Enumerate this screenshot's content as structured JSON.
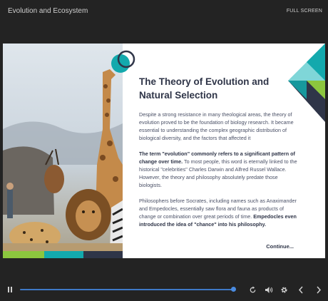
{
  "header": {
    "course_title": "Evolution and Ecosystem",
    "fullscreen_label": "FULL SCREEN"
  },
  "slide": {
    "title_line1": "The Theory of Evolution and",
    "title_line2": "Natural Selection",
    "paragraph1": "Despite a strong resistance in many theological areas, the theory of evolution proved to be the foundation of biology research. It became essential to understanding the complex geographic distribution of biological diversity, and the factors that affected it",
    "paragraph2_bold": "The term \"evolution\" commonly refers to a significant pattern of change over time.",
    "paragraph2_rest": " To most people, this word is eternally linked to the historical \"celebrities\" Charles Darwin and Alfred Russel Wallace. However, the theory and philosophy absolutely predate those biologists.",
    "paragraph3": "Philosophers before Socrates, including names such as Anaximander and Empedocles, essentially saw flora and fauna as products of change or combination over great periods of time.",
    "paragraph3_bold": "Empedocles even introduced the idea of \"chance\" into his philosophy.",
    "continue_label": "Continue..."
  },
  "player": {
    "progress": 0.99
  },
  "colors": {
    "teal": "#13a9ad",
    "green": "#8cc63e",
    "navy": "#2f3548",
    "background": "#232323",
    "progress": "#3e79c7"
  }
}
